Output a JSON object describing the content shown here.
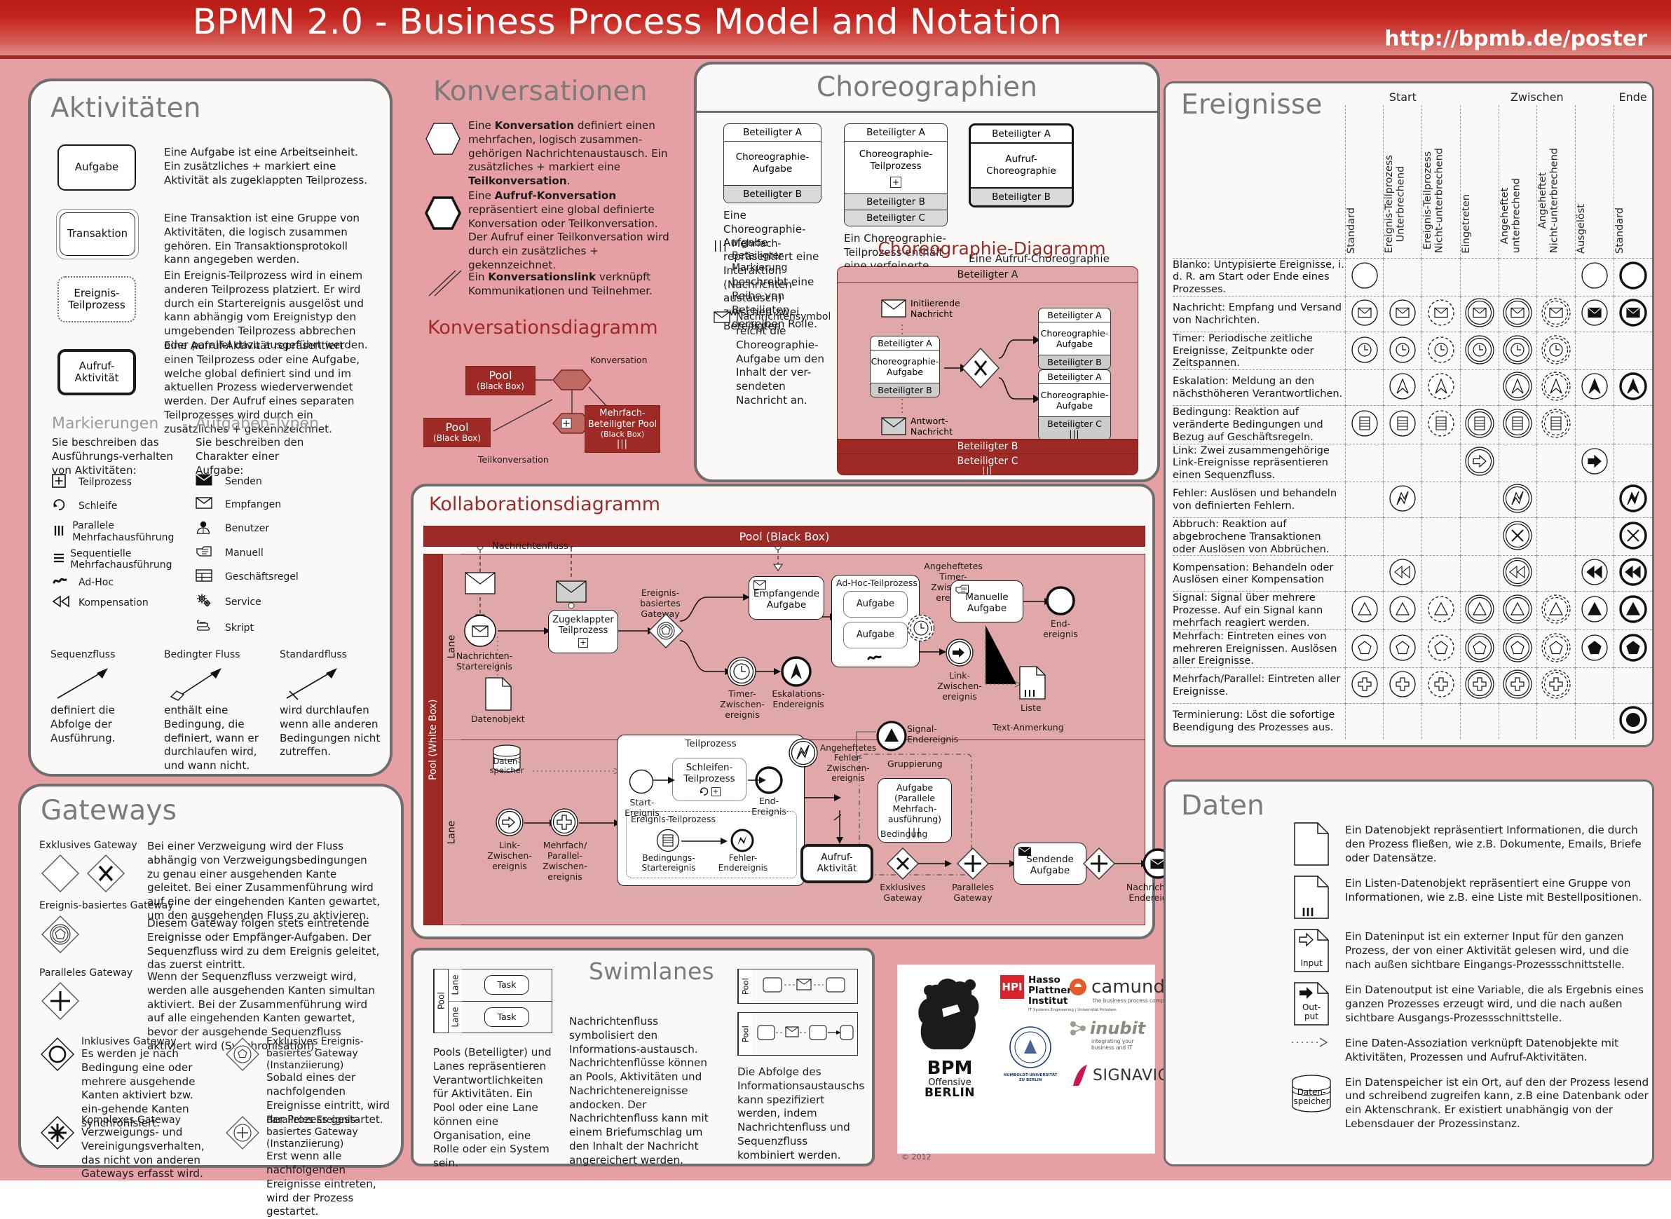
{
  "header": {
    "title": "BPMN 2.0 - Business Process Model and Notation",
    "url": "http://bpmb.de/poster",
    "bar_color": "#c4221c"
  },
  "aktivitaeten": {
    "title": "Aktivitäten",
    "items": [
      {
        "shape_label": "Aufgabe",
        "text": "Eine Aufgabe ist eine Arbeitseinheit. Ein zusätzliches + markiert eine Aktivität als zugeklappten Teilprozess."
      },
      {
        "shape_label": "Transaktion",
        "text": "Eine Transaktion ist eine Gruppe von Aktivitäten, die logisch zusammen gehören. Ein Transaktionsprotokoll kann angegeben werden."
      },
      {
        "shape_label": "Ereignis-Teilprozess",
        "text": "Ein Ereignis-Teilprozess wird in einem anderen Teilprozess platziert. Er wird durch ein Startereignis ausgelöst und kann abhängig vom Ereignistyp den umgebenden Teilprozess abbrechen oder parallel dazu ausgeführt werden."
      },
      {
        "shape_label": "Aufruf-Aktivität",
        "text": "Eine Aufruf-Aktivität repräsentiert einen Teilprozess oder eine Aufgabe, welche global definiert sind und im aktuellen Prozess wiederverwendet werden. Der Aufruf eines separaten Teilprozesses wird durch ein zusätzliches + gekennzeichnet."
      }
    ],
    "markierungen": {
      "title": "Markierungen",
      "intro": "Sie beschreiben das Ausführungs-verhalten von Aktivitäten:",
      "items": [
        {
          "icon": "plus-square-icon",
          "label": "Teilprozess"
        },
        {
          "icon": "loop-icon",
          "label": "Schleife"
        },
        {
          "icon": "parallel-bars-icon",
          "label": "Parallele Mehrfachausführung"
        },
        {
          "icon": "sequential-bars-icon",
          "label": "Sequentielle Mehrfachausführung"
        },
        {
          "icon": "tilde-icon",
          "label": "Ad-Hoc"
        },
        {
          "icon": "compensation-icon",
          "label": "Kompensation"
        }
      ]
    },
    "aufgaben_typen": {
      "title": "Aufgaben-Typen",
      "intro": "Sie beschreiben den Charakter einer Aufgabe:",
      "items": [
        {
          "icon": "envelope-filled-icon",
          "label": "Senden"
        },
        {
          "icon": "envelope-outline-icon",
          "label": "Empfangen"
        },
        {
          "icon": "user-icon",
          "label": "Benutzer"
        },
        {
          "icon": "hand-icon",
          "label": "Manuell"
        },
        {
          "icon": "table-icon",
          "label": "Geschäftsregel"
        },
        {
          "icon": "gear-icon",
          "label": "Service"
        },
        {
          "icon": "script-icon",
          "label": "Skript"
        }
      ]
    },
    "fluesse": [
      {
        "name": "Sequenzfluss",
        "desc": "definiert die Abfolge der Ausführung."
      },
      {
        "name": "Bedingter Fluss",
        "desc": "enthält eine Bedingung, die definiert, wann er durchlaufen wird, und wann nicht."
      },
      {
        "name": "Standardfluss",
        "desc": "wird durchlaufen wenn alle anderen Bedingungen nicht zutreffen."
      }
    ]
  },
  "gateways": {
    "title": "Gateways",
    "left": [
      {
        "name": "Exklusives Gateway",
        "icon": "exclusive-gateway-icon"
      },
      {
        "name": "Ereignis-basiertes Gateway",
        "icon": "event-based-gateway-icon"
      },
      {
        "name": "Paralleles Gateway",
        "icon": "parallel-gateway-icon"
      }
    ],
    "descriptions": [
      "Bei einer Verzweigung wird der Fluss abhängig von Verzweigungsbedingungen zu genau einer ausgehenden Kante geleitet. Bei einer Zusammenführung wird auf eine der eingehenden Kanten gewartet, um den ausgehenden Fluss zu aktivieren.",
      "Diesem Gateway folgen stets eintretende Ereignisse oder Empfänger-Aufgaben. Der Sequenzfluss wird zu dem Ereignis geleitet, das zuerst eintritt.",
      "Wenn der Sequenzfluss verzweigt wird, werden alle ausgehenden Kanten simultan aktiviert. Bei der Zusammenführung wird auf alle eingehenden Kanten gewartet, bevor der ausgehende Sequenzfluss aktiviert wird (Synchronisation)."
    ],
    "bottom": [
      {
        "icon": "inclusive-gateway-icon",
        "title": "Inklusives Gateway",
        "text": "Es werden je nach Bedingung eine oder mehrere ausgehende Kanten aktiviert bzw. ein-gehende Kanten synchronisiert."
      },
      {
        "icon": "exclusive-event-gateway-instantiate-icon",
        "title": "Exklusives Ereignis-basiertes Gateway (Instanziierung)",
        "text": "Sobald eines der nachfolgenden Ereignisse eintritt, wird der Prozess gestartet."
      },
      {
        "icon": "complex-gateway-icon",
        "title": "Komplexes Gateway",
        "text": "Verzweigungs- und Vereinigungsverhalten, das nicht von anderen Gateways erfasst wird."
      },
      {
        "icon": "parallel-event-gateway-instantiate-icon",
        "title": "Paralleles Ereignis-basiertes Gateway (Instanziierung)",
        "text": "Erst wenn alle nachfolgenden Ereignisse eintreten, wird der Prozess gestartet."
      }
    ]
  },
  "konversationen": {
    "title": "Konversationen",
    "items": [
      {
        "icon": "hexagon-thin-icon",
        "html": "Eine <b>Konversation</b> definiert einen mehrfachen, logisch zusammen-gehörigen Nachrichtenaustausch. Ein zusätzliches + markiert eine <b>Teilkonversation</b>."
      },
      {
        "icon": "hexagon-bold-icon",
        "html": "Eine <b>Aufruf-Konversation</b> repräsentiert eine global definierte Konversation oder Teilkonversation. Der Aufruf einer Teilkonversation wird durch ein zusätzliches + gekennzeichnet."
      },
      {
        "icon": "conversation-link-icon",
        "html": "Ein <b>Konversationslink</b> verknüpft Kommunikationen und Teilnehmer."
      }
    ],
    "diagram": {
      "title": "Konversationsdiagramm",
      "pool_left": {
        "line1": "Pool",
        "line2": "(Black Box)"
      },
      "pool_top": {
        "line1": "Pool",
        "line2": "(Black Box)"
      },
      "pool_right": {
        "line1": "Mehrfach-",
        "line2": "Beteiligter Pool",
        "line3": "(Black Box)"
      },
      "edge_top": "Konversation",
      "edge_bottom": "Teilkonversation"
    }
  },
  "choreographien": {
    "title": "Choreographien",
    "cards": [
      {
        "top": "Beteiligter A",
        "mid": [
          "Choreographie-",
          "Aufgabe"
        ],
        "bottom": [
          "Beteiligter B"
        ],
        "marker": ""
      },
      {
        "top": "Beteiligter A",
        "mid": [
          "Choreographie-",
          "Teilprozess"
        ],
        "bottom": [
          "Beteiligter B",
          "Beteiligter C"
        ],
        "marker": "+"
      },
      {
        "top": "Beteiligter A",
        "mid": [
          "Aufruf-",
          "Choreographie"
        ],
        "bottom": [
          "Beteiligter B"
        ],
        "marker": ""
      }
    ],
    "descs": [
      "Eine Choreographie-Aufgabe repräsentiert eine Interaktion (Nachrichten-austausch) zwischen zwei Beteiligten.",
      "Ein Choreographie-Teilprozess enthält eine verfeinerte Choreographie mit mehreren Interaktionen.",
      "Eine Aufruf-Choreographie repräsentiert einen Choreographie-Teilprozess oder eine -Aufgabe, die global definiert sind. Der Aufruf eines Choreographie-Teilprozesses wird durch ein zusätzliches + gekennzeichnet."
    ],
    "notes": [
      {
        "icon": "multi-participant-icon",
        "title": "Mehrfach-Beteiligter Markierung",
        "text": "beschreibt eine Reihe von Beteiligten derselben Rolle."
      },
      {
        "icon": "message-icon",
        "title": "Nachrichtensymbol",
        "text": "reicht die Choreographie-Aufgabe um den Inhalt der ver-sendeten Nachricht an."
      }
    ],
    "diagram": {
      "title": "Choreographie-Diagramm",
      "pool_top": "Beteiligter A",
      "pool_bottom": [
        "Beteiligter B",
        "Beteiligter C"
      ],
      "msg_init": [
        "Initiierende",
        "Nachricht"
      ],
      "msg_reply": [
        "Antwort-",
        "Nachricht"
      ],
      "task_left": {
        "top": "Beteiligter A",
        "mid": [
          "Choreographie-",
          "Aufgabe"
        ],
        "bottom": "Beteiligter B"
      },
      "task_up": {
        "top": "Beteiligter A",
        "mid": [
          "Choreographie-",
          "Aufgabe"
        ],
        "bottom": "Beteiligter B"
      },
      "task_down": {
        "top": "Beteiligter A",
        "mid": [
          "Choreographie-",
          "Aufgabe"
        ],
        "bottom": "Beteiligter C"
      },
      "gateway": "X"
    }
  },
  "kollaboration": {
    "title": "Kollaborationsdiagramm",
    "pool_black": "Pool (Black Box)",
    "pool_white": "Pool (White Box)",
    "lane1": "Lane",
    "lane2": "Lane",
    "labels": {
      "nachrichtenfluss": "Nachrichtenfluss",
      "nachrichten_startereignis": [
        "Nachrichten-",
        "Startereignis"
      ],
      "datenobjekt": "Datenobjekt",
      "zugeklappter_teilprozess": [
        "Zugeklappter",
        "Teilprozess"
      ],
      "ereignis_basiertes_gateway": [
        "Ereignis-",
        "basiertes",
        "Gateway"
      ],
      "empfangende_aufgabe": [
        "Empfangende",
        "Aufgabe"
      ],
      "timer_zwischenereignis": [
        "Timer-",
        "Zwischen-",
        "ereignis"
      ],
      "eskalations_endereignis": [
        "Eskalations-",
        "Endereignis"
      ],
      "adhoc_teilprozess": "Ad-Hoc-Teilprozess",
      "aufgabe": "Aufgabe",
      "angeheftetes_timer": [
        "Angeheftetes",
        "Timer-",
        "Zwischen-",
        "ereignis"
      ],
      "manuelle_aufgabe": [
        "Manuelle",
        "Aufgabe"
      ],
      "endereignis": [
        "End-",
        "ereignis"
      ],
      "link_zwischenereignis": [
        "Link-",
        "Zwischen-",
        "ereignis"
      ],
      "liste": "Liste",
      "datenspeicher": [
        "Daten-",
        "speicher"
      ],
      "teilprozess": "Teilprozess",
      "start_ereignis": [
        "Start-",
        "Ereignis"
      ],
      "schleifen_teilprozess": [
        "Schleifen-",
        "Teilprozess"
      ],
      "end_ereignis": [
        "End-",
        "Ereignis"
      ],
      "ereignis_teilprozess": "Ereignis-Teilprozess",
      "bedingungs_startereignis": [
        "Bedingungs-",
        "Startereignis"
      ],
      "fehler_endereignis": [
        "Fehler-",
        "Endereignis"
      ],
      "link_zwischenereignis2": [
        "Link-",
        "Zwischen-",
        "ereignis"
      ],
      "mehrfach_parallel": [
        "Mehrfach/",
        "Parallel-",
        "Zwischen-",
        "ereignis"
      ],
      "angeheftetes_fehler": [
        "Angeheftetes",
        "Fehler-",
        "Zwischen-",
        "ereignis"
      ],
      "signal_endereignis": [
        "Signal-",
        "Endereignis"
      ],
      "text_anmerkung": "Text-Anmerkung",
      "gruppierung": "Gruppierung",
      "aufgabe_parallel": [
        "Aufgabe",
        "(Parallele",
        "Mehrfach-",
        "ausführung)"
      ],
      "aufruf_aktivitaet": [
        "Aufruf-",
        "Aktivität"
      ],
      "exklusives_gateway": [
        "Exklusives",
        "Gateway"
      ],
      "bedingung": "Bedingung",
      "paralleles_gateway": [
        "Paralleles",
        "Gateway"
      ],
      "sendende_aufgabe": [
        "Sendende",
        "Aufgabe"
      ],
      "nachrichten_endereignis": [
        "Nachrichten-",
        "Endereignis"
      ]
    }
  },
  "swimlanes": {
    "title": "Swimlanes",
    "pool_label": "Pool",
    "lane_label": "Lane",
    "task_label": "Task",
    "left_text": "Pools (Beteiligter) und Lanes repräsentieren Verantwortlichkeiten für Aktivitäten. Ein Pool oder eine Lane können eine Organisation, eine Rolle oder ein System sein.",
    "mid_text": "Nachrichtenfluss symbolisiert den Informations-austausch. Nachrichtenflüsse können an Pools, Aktivitäten und Nachrichtenereignisse andocken. Der Nachrichtenfluss kann mit einem Briefumschlag um den Inhalt der Nachricht angereichert werden.",
    "right_text": "Die Abfolge des Informationsaustauschs kann spezifiziert werden, indem Nachrichtenfluss und Sequenzfluss kombiniert werden."
  },
  "ereignisse": {
    "title": "Ereignisse",
    "groups": [
      {
        "label": "Start",
        "span": 3
      },
      {
        "label": "Zwischen",
        "span": 4
      },
      {
        "label": "Ende",
        "span": 1
      }
    ],
    "columns": [
      "Standard",
      "Ereignis-Teilprozess Unterbrechend",
      "Ereignis-Teilprozess Nicht-unterbrechend",
      "Eingetreten",
      "Angeheftet unterbrechend",
      "Angeheftet Nicht-unterbrechend",
      "Ausgelöst",
      "Standard"
    ],
    "rows": [
      {
        "desc": "Blanko: Untypisierte Ereignisse, i. d. R. am Start oder Ende eines Prozesses.",
        "glyph": "none",
        "cells": [
          "thin",
          "",
          "",
          "",
          "",
          "",
          "thin",
          "bold"
        ]
      },
      {
        "desc": "Nachricht: Empfang und Versand von Nachrichten.",
        "glyph": "envelope",
        "cells": [
          "thin",
          "thin",
          "dashed",
          "double",
          "double",
          "dashed-double",
          "thin-filled",
          "bold-filled"
        ]
      },
      {
        "desc": "Timer: Periodische zeitliche Ereignisse, Zeitpunkte oder Zeitspannen.",
        "glyph": "clock",
        "cells": [
          "thin",
          "thin",
          "dashed",
          "double",
          "double",
          "dashed-double",
          "",
          ""
        ]
      },
      {
        "desc": "Eskalation: Meldung an den nächsthöheren Verantwortlichen.",
        "glyph": "escalation",
        "cells": [
          "",
          "thin",
          "dashed",
          "",
          "double",
          "dashed-double",
          "thin-filled",
          "bold-filled"
        ]
      },
      {
        "desc": "Bedingung: Reaktion auf veränderte Bedingungen und Bezug auf Geschäftsregeln.",
        "glyph": "condition",
        "cells": [
          "thin",
          "thin",
          "dashed",
          "double",
          "double",
          "dashed-double",
          "",
          ""
        ]
      },
      {
        "desc": "Link: Zwei zusammengehörige Link-Ereignisse repräsentieren einen Sequenzfluss.",
        "glyph": "link",
        "cells": [
          "",
          "",
          "",
          "double",
          "",
          "",
          "thin-filled",
          ""
        ]
      },
      {
        "desc": "Fehler: Auslösen und behandeln von definierten Fehlern.",
        "glyph": "error",
        "cells": [
          "",
          "thin",
          "",
          "",
          "double",
          "",
          "",
          "bold-filled"
        ]
      },
      {
        "desc": "Abbruch: Reaktion auf abgebrochene Transaktionen oder Auslösen von Abbrüchen.",
        "glyph": "cancel",
        "cells": [
          "",
          "",
          "",
          "",
          "double",
          "",
          "",
          "bold-filled"
        ]
      },
      {
        "desc": "Kompensation: Behandeln oder Auslösen einer Kompensation",
        "glyph": "compensation",
        "cells": [
          "",
          "thin",
          "",
          "",
          "double",
          "",
          "thin-filled",
          "bold-filled"
        ]
      },
      {
        "desc": "Signal: Signal über mehrere Prozesse. Auf ein Signal kann mehrfach reagiert werden.",
        "glyph": "signal",
        "cells": [
          "thin",
          "thin",
          "dashed",
          "double",
          "double",
          "dashed-double",
          "thin-filled",
          "bold-filled"
        ]
      },
      {
        "desc": "Mehrfach: Eintreten eines von mehreren Ereignissen. Auslösen aller Ereignisse.",
        "glyph": "multiple",
        "cells": [
          "thin",
          "thin",
          "dashed",
          "double",
          "double",
          "dashed-double",
          "thin-filled",
          "bold-filled"
        ]
      },
      {
        "desc": "Mehrfach/Parallel: Eintreten aller Ereignisse.",
        "glyph": "parallel-multiple",
        "cells": [
          "thin",
          "thin",
          "dashed",
          "double",
          "double",
          "dashed-double",
          "",
          ""
        ]
      },
      {
        "desc": "Terminierung: Löst die sofortige Beendigung des Prozesses aus.",
        "glyph": "terminate",
        "cells": [
          "",
          "",
          "",
          "",
          "",
          "",
          "",
          "bold-filled"
        ]
      }
    ]
  },
  "daten": {
    "title": "Daten",
    "items": [
      {
        "icon": "data-object-icon",
        "label": "",
        "text": "Ein Datenobjekt repräsentiert Informationen, die durch den Prozess fließen, wie z.B. Dokumente, Emails, Briefe oder Datensätze."
      },
      {
        "icon": "data-list-icon",
        "label": "",
        "text": "Ein Listen-Datenobjekt repräsentiert eine Gruppe von Informationen, wie z.B. eine Liste mit Bestellpositionen."
      },
      {
        "icon": "data-input-icon",
        "label": "Input",
        "text": "Ein Dateninput ist ein externer Input für den ganzen Prozess, der von einer Aktivität gelesen wird, und die nach außen sichtbare Eingangs-Prozessschnittstelle."
      },
      {
        "icon": "data-output-icon",
        "label": "Out-put",
        "text": "Ein Datenoutput ist eine Variable, die als Ergebnis eines ganzen Prozesses erzeugt wird, und die nach außen sichtbare Ausgangs-Prozessschnittstelle."
      },
      {
        "icon": "data-association-icon",
        "label": "",
        "text": "Eine Daten-Assoziation verknüpft Datenobjekte mit Aktivitäten, Prozessen und Aufruf-Aktivitäten."
      },
      {
        "icon": "data-store-icon",
        "label": "Daten-speicher",
        "text": "Ein Datenspeicher ist ein Ort, auf den der Prozess lesend und schreibend zugreifen kann, z.B eine Datenbank oder ein Aktenschrank. Er existiert unabhängig von der Lebensdauer der Prozessinstanz."
      }
    ]
  },
  "sponsors": {
    "copyright": "© 2012",
    "logos": [
      {
        "name": "bpm-offensive-berlin",
        "lines": [
          "BPM",
          "Offensive",
          "BERLIN"
        ]
      },
      {
        "name": "hpi-hasso-plattner-institut",
        "lines": [
          "HPI",
          "Hasso",
          "Plattner",
          "Institut",
          "IT Systems Engineering | Universität Potsdam"
        ]
      },
      {
        "name": "camunda",
        "lines": [
          "camunda",
          "the business process company"
        ]
      },
      {
        "name": "inubit",
        "lines": [
          "inubit",
          "integrating your business and IT"
        ]
      },
      {
        "name": "humboldt-universitaet-zu-berlin",
        "lines": [
          "HUMBOLDT-UNIVERSITÄT",
          "ZU BERLIN"
        ]
      },
      {
        "name": "signavio",
        "lines": [
          "SIGNAVIO"
        ]
      }
    ]
  }
}
